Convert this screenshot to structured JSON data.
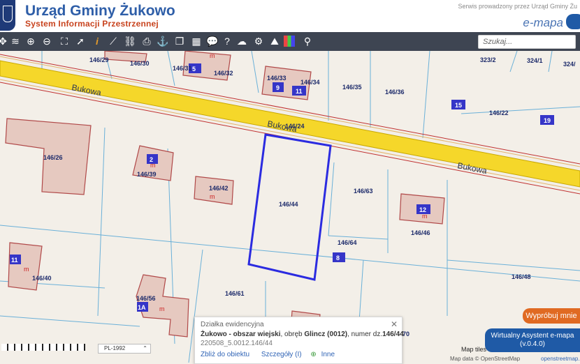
{
  "header": {
    "title": "Urząd Gminy Żukowo",
    "subtitle": "System Informacji Przestrzennej",
    "served_by": "Serwis prowadzony przez Urząd Gminy Żu",
    "brand": "e-mapa"
  },
  "toolbar": {
    "icons": [
      "move-icon",
      "layers-icon",
      "zoom-in-icon",
      "zoom-out-icon",
      "zoom-extent-icon",
      "pointer-icon",
      "info-icon",
      "measure-icon",
      "link-icon",
      "print-icon",
      "anchor-icon",
      "copy-icon",
      "layout-icon",
      "comment-icon",
      "help-icon",
      "cloud-icon",
      "settings-icon",
      "road-icon",
      "color-grid-icon",
      "share-icon"
    ],
    "search_placeholder": "Szukaj..."
  },
  "map": {
    "streets": [
      "Bukowa",
      "Bukowa",
      "Bukowa"
    ],
    "parcels": [
      "146/29",
      "146/30",
      "146/31",
      "146/32",
      "146/33",
      "146/34",
      "146/35",
      "146/36",
      "323/2",
      "324/1",
      "324/",
      "146/22",
      "146/26",
      "146/39",
      "146/42",
      "146/24",
      "146/44",
      "146/63",
      "146/46",
      "146/64",
      "146/40",
      "146/56",
      "146/61",
      "146/48",
      "70"
    ],
    "buildings": [
      "5",
      "9",
      "11",
      "15",
      "19",
      "2",
      "12",
      "8",
      "1A",
      "11"
    ],
    "building_marker": "m",
    "selected_parcel": "146/44"
  },
  "popup": {
    "title": "Działka ewidencyjna",
    "location_bold": "Żukowo - obszar wiejski",
    "location_rest": ", obręb ",
    "obreb": "Glincz (0012)",
    "numer_label": ", numer dz.",
    "numer": "146/44",
    "id": "220508_5.0012.146/44",
    "links": [
      "Zbliż do obiektu",
      "Szczegóły (I)",
      "Inne"
    ]
  },
  "assistant": {
    "try_button": "Wypróbuj mnie",
    "label": "Wirtualny Asystent e-mapa",
    "version": "(v.0.4.0)"
  },
  "footer": {
    "projection": "PL-1992",
    "map_tiles": "Map tiles",
    "map_data": "Map data © OpenStreetMap",
    "osm": "openstreetmap.org/c"
  }
}
